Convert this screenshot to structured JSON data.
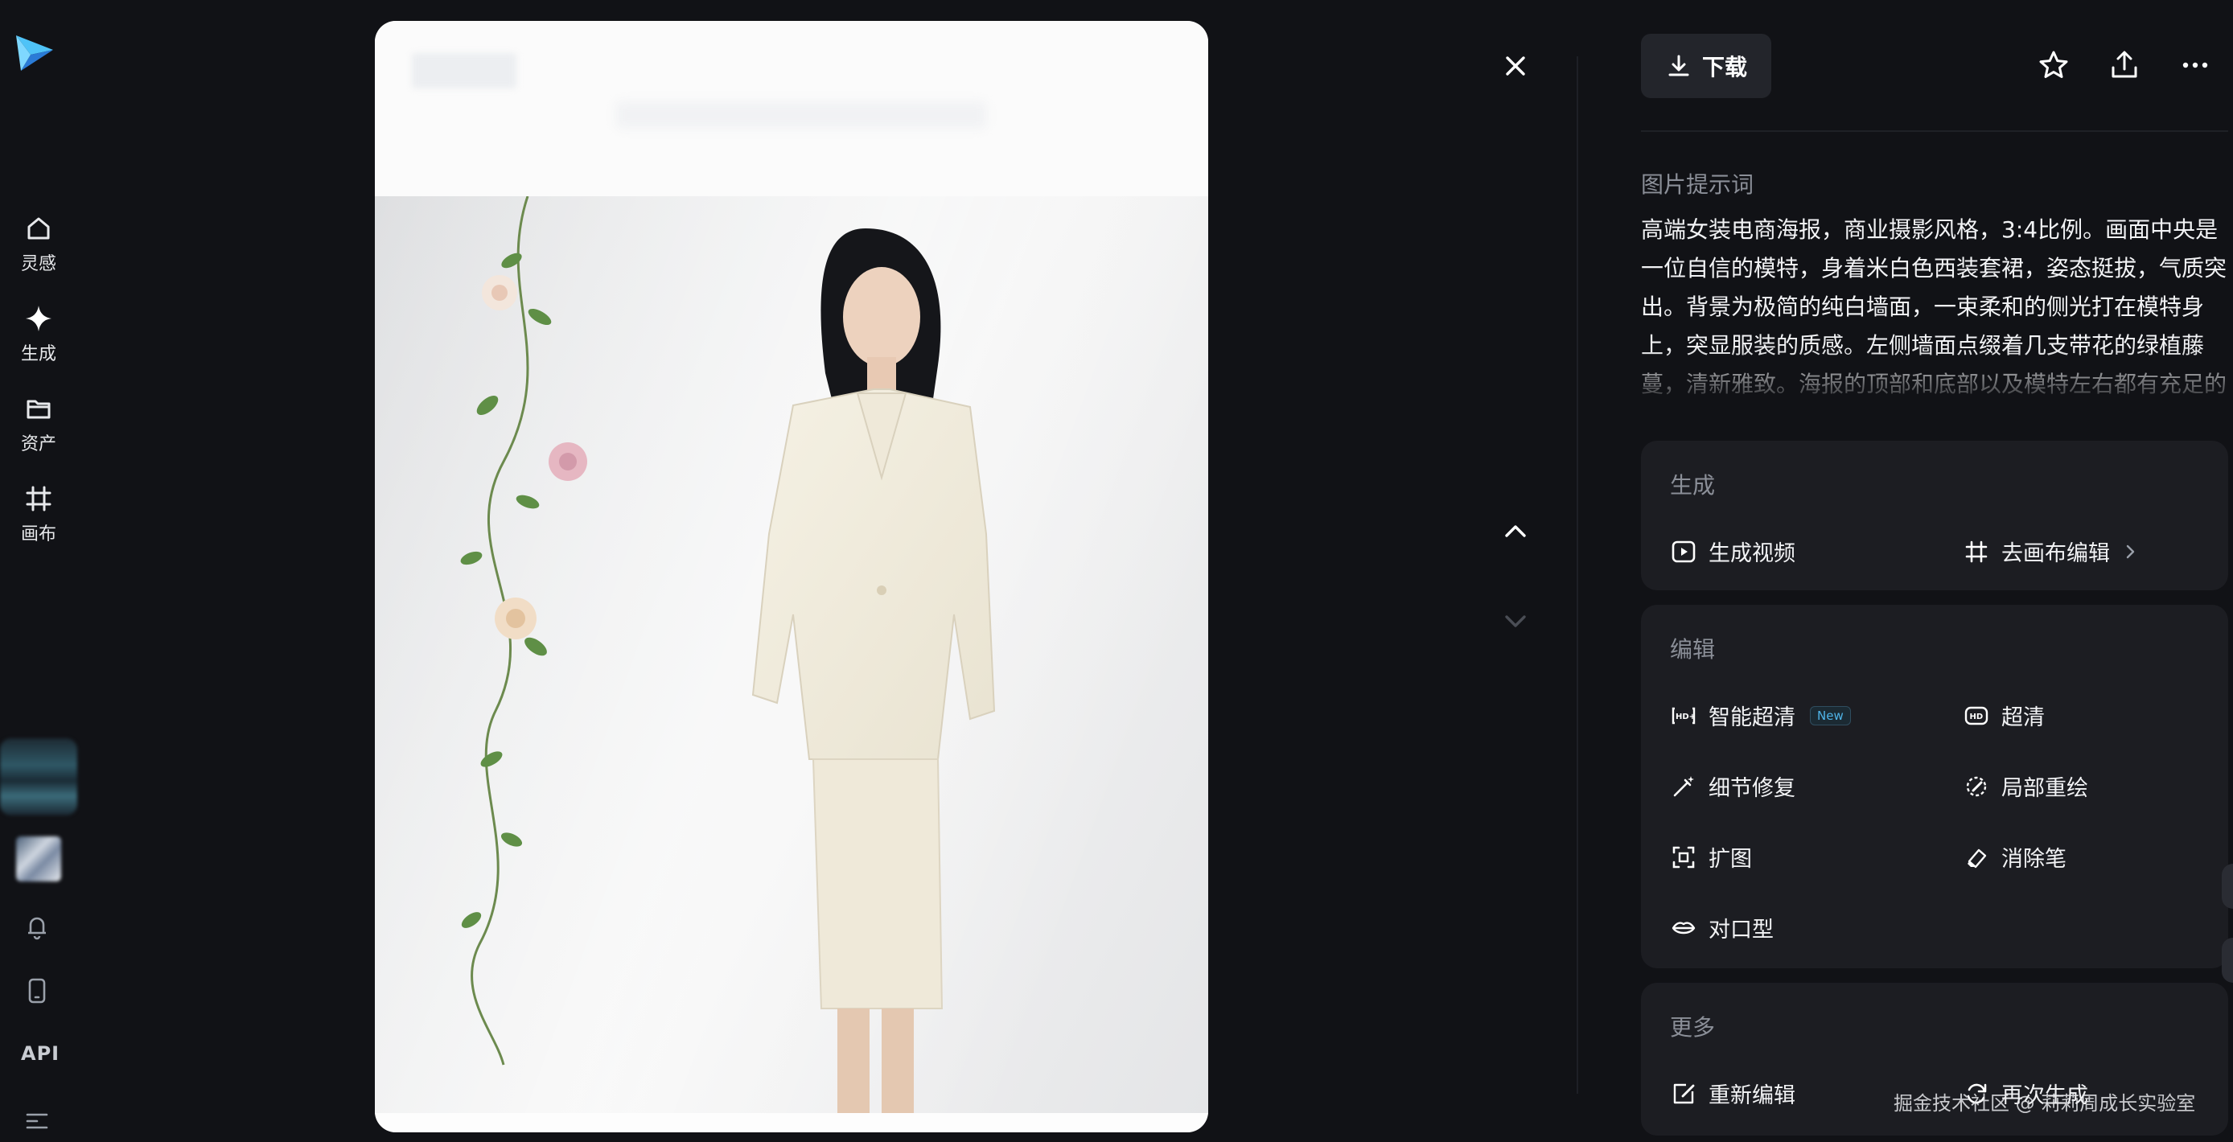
{
  "sidebar": {
    "nav": [
      {
        "label": "灵感",
        "icon": "home-icon"
      },
      {
        "label": "生成",
        "icon": "sparkle-icon"
      },
      {
        "label": "资产",
        "icon": "folder-icon"
      },
      {
        "label": "画布",
        "icon": "canvas-frame-icon"
      }
    ],
    "bottom_icons": [
      "bell-icon",
      "mobile-icon",
      "menu-icon"
    ],
    "api_label": "API"
  },
  "viewer": {
    "controls": [
      "close-icon",
      "chevron-up-icon",
      "chevron-down-icon"
    ]
  },
  "panel": {
    "download_label": "下载",
    "top_actions": [
      "star-icon",
      "share-icon",
      "more-icon"
    ],
    "prompt_title": "图片提示词",
    "prompt_text": "高端女装电商海报，商业摄影风格，3:4比例。画面中央是一位自信的模特，身着米白色西装套裙，姿态挺拔，气质突出。背景为极简的纯白墙面，一束柔和的侧光打在模特身上，突显服装的质感。左侧墙面点缀着几支带花的绿植藤蔓，清新雅致。海报的顶部和底部以及模特左右都有充足的",
    "sections": {
      "generate": {
        "title": "生成",
        "actions": [
          {
            "label": "生成视频",
            "icon": "play-video-icon"
          },
          {
            "label": "去画布编辑",
            "icon": "canvas-frame-icon"
          }
        ]
      },
      "edit": {
        "title": "编辑",
        "new_badge": "New",
        "actions": [
          {
            "label": "智能超清",
            "icon": "hd-plus-icon"
          },
          {
            "label": "超清",
            "icon": "hd-icon"
          },
          {
            "label": "细节修复",
            "icon": "magic-wand-icon"
          },
          {
            "label": "局部重绘",
            "icon": "brush-circle-icon"
          },
          {
            "label": "扩图",
            "icon": "expand-icon"
          },
          {
            "label": "消除笔",
            "icon": "eraser-icon"
          },
          {
            "label": "对口型",
            "icon": "lips-icon"
          }
        ]
      },
      "more": {
        "title": "更多",
        "actions": [
          {
            "label": "重新编辑",
            "icon": "edit-icon"
          },
          {
            "label": "再次生成",
            "icon": "regenerate-icon"
          }
        ]
      }
    }
  },
  "watermark": "掘金技术社区 @ 莉莉周成长实验室",
  "colors": {
    "background": "#111216",
    "panel_card": "#1c1d22",
    "text_primary": "#f2f3f5",
    "text_secondary": "#8b8f98",
    "accent_new": "#4fb4e8"
  }
}
